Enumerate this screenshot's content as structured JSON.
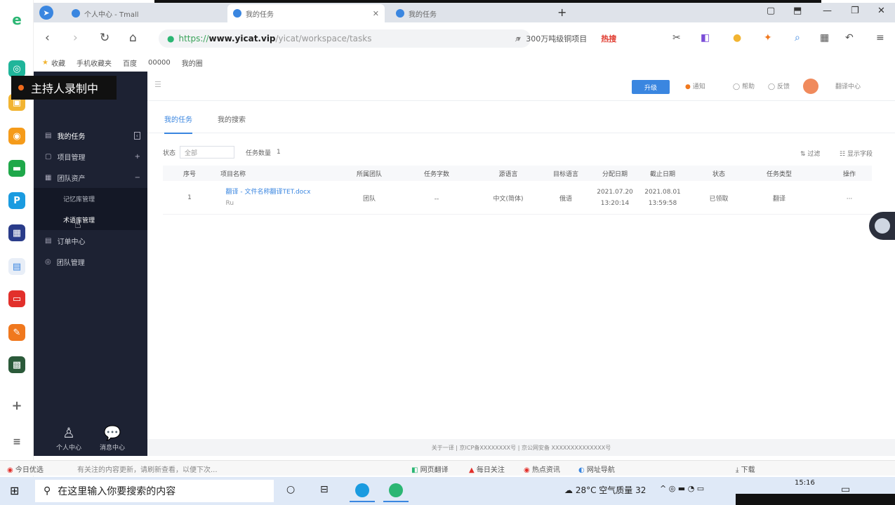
{
  "browser": {
    "tabs": [
      {
        "label": "个人中心 - Tmall"
      },
      {
        "label": "我的任务"
      },
      {
        "label": "我的任务"
      }
    ],
    "new_tab": "+",
    "url_scheme": "https://",
    "url_domain": "www.yicat.vip",
    "url_path": "/yicat/workspace/tasks",
    "search_text": "300万吨级铜项目",
    "search_hot": "热搜",
    "bookmarks": [
      "收藏",
      "手机收藏夹",
      "百度",
      "00000",
      "我的圈"
    ]
  },
  "recording": {
    "label": "主持人录制中"
  },
  "sidebar": {
    "items": [
      {
        "label": "我的任务"
      },
      {
        "label": "项目管理"
      },
      {
        "label": "团队资产"
      },
      {
        "label": "记忆库管理"
      },
      {
        "label": "术语库管理"
      },
      {
        "label": "订单中心"
      },
      {
        "label": "团队管理"
      }
    ],
    "bottom": [
      {
        "label": "个人中心"
      },
      {
        "label": "消息中心"
      }
    ]
  },
  "header": {
    "button": "升级",
    "items": [
      "通知",
      "帮助",
      "反馈",
      "翻译中心"
    ]
  },
  "content_tabs": [
    "我的任务",
    "我的搜索"
  ],
  "filter": {
    "status_label": "状态",
    "status_value": "全部",
    "count_label": "任务数量",
    "count_value": "1",
    "tool1": "过滤",
    "tool2": "显示字段"
  },
  "table": {
    "columns": [
      "序号",
      "项目名称",
      "所属团队",
      "任务字数",
      "源语言",
      "目标语言",
      "分配日期",
      "截止日期",
      "状态",
      "任务类型",
      "操作"
    ],
    "rows": [
      {
        "index": "1",
        "name_line1": "翻译 - 文件名称翻译TET.docx",
        "name_line2": "Ru",
        "team": "团队",
        "words": "--",
        "source": "中文(简体)",
        "target": "俄语",
        "assign_line1": "2021.07.20",
        "assign_line2": "13:20:14",
        "due_line1": "2021.08.01",
        "due_line2": "13:59:58",
        "status": "已领取",
        "type": "翻译",
        "action": "···"
      }
    ]
  },
  "footer": {
    "text": "关于一译 | 京ICP备XXXXXXXX号 | 京公网安备 XXXXXXXXXXXXXX号"
  },
  "statusbar": {
    "left": "今日优选",
    "middle": "有关注的内容更新，请刷新查看，以便下次...",
    "items": [
      "网页翻译",
      "每日关注",
      "热点资讯",
      "网址导航",
      "下载"
    ]
  },
  "taskbar": {
    "search_placeholder": "在这里输入你要搜索的内容",
    "weather": "28°C  空气质量 32",
    "time": "15:16"
  }
}
